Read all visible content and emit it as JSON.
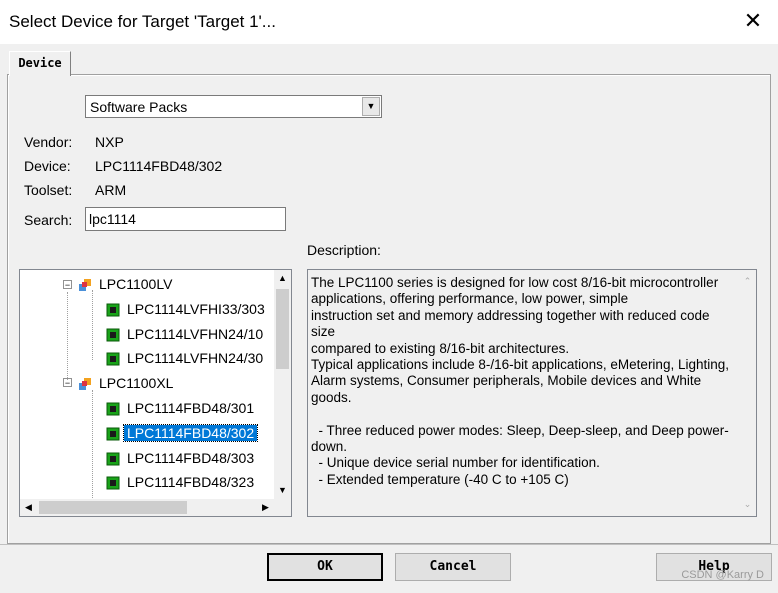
{
  "window": {
    "title": "Select Device for Target 'Target 1'...",
    "close_glyph": "✕"
  },
  "tabs": [
    {
      "label": "Device"
    }
  ],
  "pack_select": {
    "value": "Software Packs"
  },
  "info": {
    "vendor_label": "Vendor:",
    "vendor": "NXP",
    "device_label": "Device:",
    "device": "LPC1114FBD48/302",
    "toolset_label": "Toolset:",
    "toolset": "ARM",
    "search_label": "Search:",
    "search_value": "lpc1114"
  },
  "tree": {
    "groups": [
      {
        "label": "LPC1100LV",
        "items": [
          "LPC1114LVFHI33/303",
          "LPC1114LVFHN24/10",
          "LPC1114LVFHN24/30"
        ]
      },
      {
        "label": "LPC1100XL",
        "items": [
          "LPC1114FBD48/301",
          "LPC1114FBD48/302",
          "LPC1114FBD48/303",
          "LPC1114FBD48/323"
        ]
      }
    ],
    "selected": "LPC1114FBD48/302"
  },
  "description": {
    "label": "Description:",
    "text": "The LPC1100 series is designed for low cost 8/16-bit microcontroller\napplications, offering performance, low power, simple\ninstruction set and memory addressing together with reduced code size\ncompared to existing 8/16-bit architectures.\nTypical applications include 8-/16-bit applications, eMetering, Lighting,\nAlarm systems, Consumer peripherals, Mobile devices and White\ngoods.\n\n  - Three reduced power modes: Sleep, Deep-sleep, and Deep power-\ndown.\n  - Unique device serial number for identification.\n  - Extended temperature (-40 C to +105 C)"
  },
  "buttons": {
    "ok": "OK",
    "cancel": "Cancel",
    "help": "Help"
  },
  "watermark": "CSDN @Karry D",
  "colors": {
    "selection": "#0078d7",
    "chip_green": "#19a319"
  }
}
